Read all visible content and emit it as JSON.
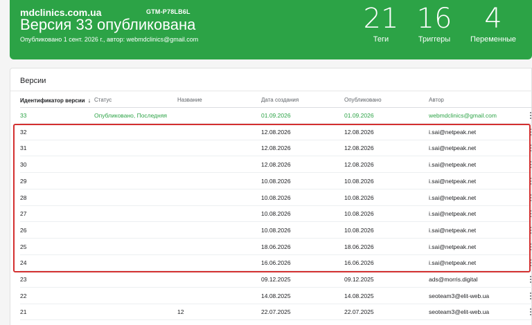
{
  "banner": {
    "site": "mdclinics.com.ua",
    "container_id": "GTM-P78LB6L",
    "title": "Версия 33 опубликована",
    "subtitle": "Опубликовано 1 сент. 2026 г., автор: webmdclinics@gmail.com",
    "stats": [
      {
        "value": "21",
        "label": "Теги"
      },
      {
        "value": "16",
        "label": "Триггеры"
      },
      {
        "value": "4",
        "label": "Переменные"
      }
    ]
  },
  "versions": {
    "title": "Версии",
    "columns": {
      "id": "Идентификатор версии",
      "sort_arrow": "↓",
      "status": "Статус",
      "name": "Название",
      "created": "Дата создания",
      "published": "Опубликовано",
      "author": "Автор"
    },
    "rows": [
      {
        "id": "33",
        "status": "Опубликовано, Последняя",
        "name": "",
        "created": "01.09.2026",
        "published": "01.09.2026",
        "author": "webmdclinics@gmail.com"
      },
      {
        "id": "32",
        "status": "",
        "name": "",
        "created": "12.08.2026",
        "published": "12.08.2026",
        "author": "i.sai@netpeak.net"
      },
      {
        "id": "31",
        "status": "",
        "name": "",
        "created": "12.08.2026",
        "published": "12.08.2026",
        "author": "i.sai@netpeak.net"
      },
      {
        "id": "30",
        "status": "",
        "name": "",
        "created": "12.08.2026",
        "published": "12.08.2026",
        "author": "i.sai@netpeak.net"
      },
      {
        "id": "29",
        "status": "",
        "name": "",
        "created": "10.08.2026",
        "published": "10.08.2026",
        "author": "i.sai@netpeak.net"
      },
      {
        "id": "28",
        "status": "",
        "name": "",
        "created": "10.08.2026",
        "published": "10.08.2026",
        "author": "i.sai@netpeak.net"
      },
      {
        "id": "27",
        "status": "",
        "name": "",
        "created": "10.08.2026",
        "published": "10.08.2026",
        "author": "i.sai@netpeak.net"
      },
      {
        "id": "26",
        "status": "",
        "name": "",
        "created": "10.08.2026",
        "published": "10.08.2026",
        "author": "i.sai@netpeak.net"
      },
      {
        "id": "25",
        "status": "",
        "name": "",
        "created": "18.06.2026",
        "published": "18.06.2026",
        "author": "i.sai@netpeak.net"
      },
      {
        "id": "24",
        "status": "",
        "name": "",
        "created": "16.06.2026",
        "published": "16.06.2026",
        "author": "i.sai@netpeak.net"
      },
      {
        "id": "23",
        "status": "",
        "name": "",
        "created": "09.12.2025",
        "published": "09.12.2025",
        "author": "ads@morris.digital"
      },
      {
        "id": "22",
        "status": "",
        "name": "",
        "created": "14.08.2025",
        "published": "14.08.2025",
        "author": "seoteam3@elit-web.ua"
      },
      {
        "id": "21",
        "status": "",
        "name": "12",
        "created": "22.07.2025",
        "published": "22.07.2025",
        "author": "seoteam3@elit-web.ua"
      }
    ]
  },
  "colors": {
    "banner_green": "#2ca346",
    "published_green": "#2ca346",
    "highlight_red": "#d32f2f"
  },
  "icons": {
    "sort": "arrow-down-icon",
    "row_menu": "more-vert-icon"
  }
}
